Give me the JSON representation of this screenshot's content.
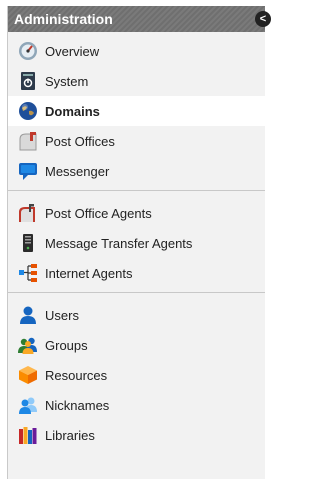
{
  "header": {
    "title": "Administration",
    "collapse_glyph": "<"
  },
  "groups": [
    {
      "items": [
        {
          "label": "Overview",
          "icon": "gauge-icon"
        },
        {
          "label": "System",
          "icon": "server-power-icon"
        },
        {
          "label": "Domains",
          "icon": "globe-icon",
          "selected": true
        },
        {
          "label": "Post Offices",
          "icon": "post-office-icon"
        },
        {
          "label": "Messenger",
          "icon": "chat-bubble-icon"
        }
      ]
    },
    {
      "items": [
        {
          "label": "Post Office Agents",
          "icon": "post-office-agent-icon"
        },
        {
          "label": "Message Transfer Agents",
          "icon": "server-tower-icon"
        },
        {
          "label": "Internet Agents",
          "icon": "network-icon"
        }
      ]
    },
    {
      "items": [
        {
          "label": "Users",
          "icon": "user-icon"
        },
        {
          "label": "Groups",
          "icon": "group-icon"
        },
        {
          "label": "Resources",
          "icon": "box-icon"
        },
        {
          "label": "Nicknames",
          "icon": "nickname-icon"
        },
        {
          "label": "Libraries",
          "icon": "books-icon"
        }
      ]
    }
  ]
}
